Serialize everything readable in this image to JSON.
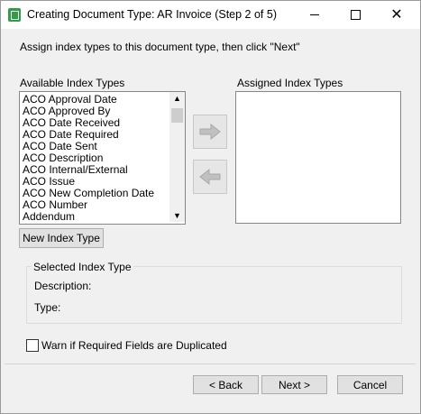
{
  "window": {
    "title": "Creating Document Type: AR Invoice (Step 2 of 5)",
    "icon": "app-document-icon",
    "minimize_icon": "minimize-icon",
    "maximize_icon": "maximize-icon",
    "close_icon": "close-icon"
  },
  "instructions": "Assign index types to this document type, then click \"Next\"",
  "available": {
    "label": "Available Index Types",
    "items": [
      "ACO Approval Date",
      "ACO Approved By",
      "ACO Date Received",
      "ACO Date Required",
      "ACO Date Sent",
      "ACO Description",
      "ACO Internal/External",
      "ACO Issue",
      "ACO New Completion Date",
      "ACO Number",
      "Addendum"
    ]
  },
  "assigned": {
    "label": "Assigned Index Types",
    "items": []
  },
  "assign_button_icon": "arrow-right-icon",
  "unassign_button_icon": "arrow-left-icon",
  "new_index_type_label": "New Index Type",
  "selected": {
    "legend": "Selected Index Type",
    "description_label": "Description:",
    "type_label": "Type:"
  },
  "warn_checkbox": {
    "label": "Warn if Required Fields are Duplicated",
    "checked": false
  },
  "footer": {
    "back_label": "< Back",
    "next_label": "Next >",
    "cancel_label": "Cancel"
  }
}
